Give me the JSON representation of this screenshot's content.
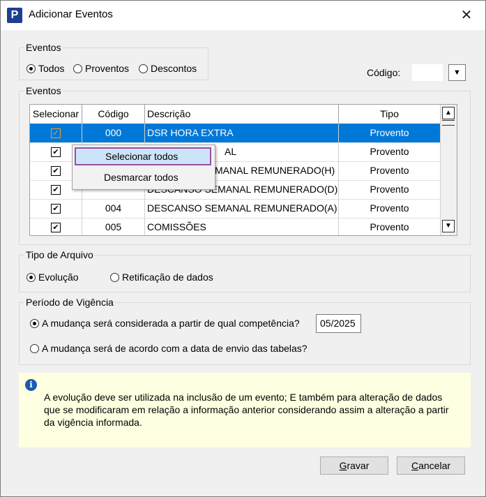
{
  "window": {
    "title": "Adicionar Eventos",
    "close": "✕",
    "app_icon": "P"
  },
  "filter": {
    "legend": "Eventos",
    "options": [
      "Todos",
      "Proventos",
      "Descontos"
    ],
    "selected": "Todos",
    "codigo_label": "Código:",
    "codigo_value": ""
  },
  "events": {
    "legend": "Eventos",
    "columns": [
      "Selecionar",
      "Código",
      "Descrição",
      "Tipo"
    ],
    "rows": [
      {
        "checked": true,
        "code": "000",
        "desc": "DSR HORA EXTRA",
        "type": "Provento",
        "selected": true
      },
      {
        "checked": true,
        "code": "",
        "desc": "AL",
        "type": "Provento"
      },
      {
        "checked": true,
        "code": "",
        "desc": "MANAL REMUNERADO(H)",
        "type": "Provento"
      },
      {
        "checked": true,
        "code": "",
        "desc": "DESCANSO SEMANAL REMUNERADO(D)",
        "type": "Provento"
      },
      {
        "checked": true,
        "code": "004",
        "desc": "DESCANSO SEMANAL REMUNERADO(A)",
        "type": "Provento"
      },
      {
        "checked": true,
        "code": "005",
        "desc": "COMISSÕES",
        "type": "Provento"
      }
    ]
  },
  "context_menu": {
    "items": [
      "Selecionar todos",
      "Desmarcar todos"
    ],
    "highlighted": "Selecionar todos"
  },
  "tipo_arquivo": {
    "legend": "Tipo de Arquivo",
    "options": [
      "Evolução",
      "Retificação de dados"
    ],
    "selected": "Evolução"
  },
  "periodo": {
    "legend": "Período de Vigência",
    "option1": "A mudança será considerada a partir de qual competência?",
    "option2": "A mudança será de acordo com a data de envio das tabelas?",
    "competencia": "05/2025",
    "selected": 1
  },
  "info": {
    "icon": "info-icon",
    "lines": [
      "A evolução deve ser utilizada na inclusão de um evento; E também para alteração de dados",
      "que se modificaram em relação a informação anterior considerando assim a alteração a partir",
      "da vigência informada."
    ]
  },
  "buttons": {
    "save_first": "G",
    "save_rest": "ravar",
    "cancel_first": "C",
    "cancel_rest": "ancelar"
  },
  "colors": {
    "selection": "#0078d7",
    "info_bg": "#ffffe1",
    "menu_highlight_border": "#9b4ea3"
  }
}
